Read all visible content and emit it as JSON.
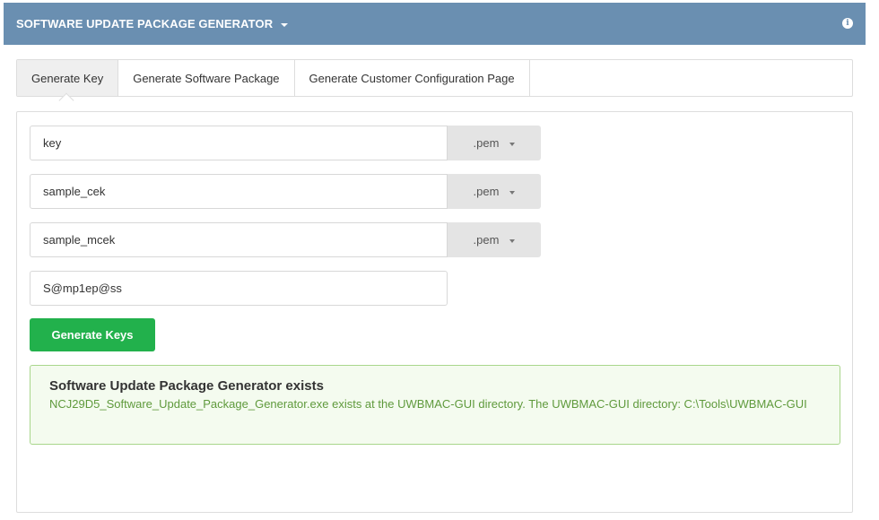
{
  "header": {
    "title": "SOFTWARE UPDATE PACKAGE GENERATOR",
    "info_icon": "info-icon"
  },
  "tabs": [
    {
      "label": "Generate Key",
      "active": true
    },
    {
      "label": "Generate Software Package",
      "active": false
    },
    {
      "label": "Generate Customer Configuration Page",
      "active": false
    }
  ],
  "form": {
    "fields": [
      {
        "value": "key",
        "extension": ".pem"
      },
      {
        "value": "sample_cek",
        "extension": ".pem"
      },
      {
        "value": "sample_mcek",
        "extension": ".pem"
      }
    ],
    "password_value": "S@mp1ep@ss",
    "generate_button": "Generate Keys"
  },
  "alert": {
    "title": "Software Update Package Generator exists",
    "message": "NCJ29D5_Software_Update_Package_Generator.exe exists at the UWBMAC-GUI directory. The UWBMAC-GUI directory: C:\\Tools\\UWBMAC-GUI"
  },
  "colors": {
    "header_bg": "#6a8fb1",
    "success_green": "#22b14c",
    "alert_bg": "#f4fbef",
    "alert_border": "#a9d68c",
    "alert_text": "#5f9a3c"
  }
}
